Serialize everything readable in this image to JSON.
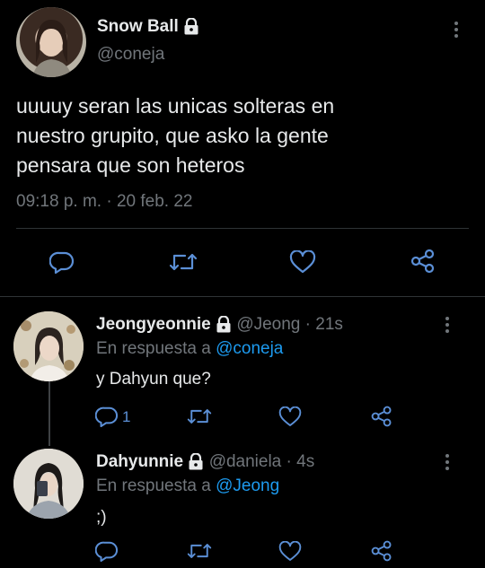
{
  "main_tweet": {
    "display_name": "Snow Ball",
    "handle": "@coneja",
    "text_lines": [
      "uuuuy seran las unicas solteras en",
      "nuestro grupito, que asko la gente",
      "pensara que son heteros"
    ],
    "timestamp": "09:18 p. m. · 20 feb. 22"
  },
  "replies": [
    {
      "display_name": "Jeongyeonnie",
      "handle": "@Jeong",
      "time": "· 21s",
      "reply_to_prefix": "En respuesta a",
      "reply_to": "@coneja",
      "text": "y Dahyun que?",
      "reply_count": "1"
    },
    {
      "display_name": "Dahyunnie",
      "handle": "@daniela",
      "time": "· 4s",
      "reply_to_prefix": "En respuesta a",
      "reply_to": "@Jeong",
      "text": ";)"
    }
  ],
  "icons": {
    "reply": "reply-icon",
    "retweet": "retweet-icon",
    "like": "heart-icon",
    "share": "share-icon",
    "lock": "lock-icon",
    "more": "more-vertical-icon"
  },
  "colors": {
    "background": "#000000",
    "text": "#e7e9ea",
    "muted": "#71767b",
    "link": "#1d9bf0",
    "divider": "#2f3336"
  }
}
